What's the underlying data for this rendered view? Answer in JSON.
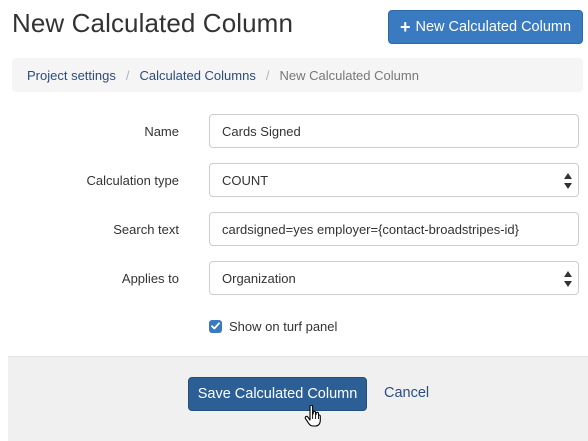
{
  "header": {
    "title": "New Calculated Column",
    "new_button_icon": "plus-icon",
    "new_button_label": "New Calculated Column"
  },
  "breadcrumb": {
    "items": [
      "Project settings",
      "Calculated Columns"
    ],
    "separator": "/",
    "current": "New Calculated Column"
  },
  "form": {
    "name": {
      "label": "Name",
      "value": "Cards Signed"
    },
    "calculation_type": {
      "label": "Calculation type",
      "value": "COUNT"
    },
    "search_text": {
      "label": "Search text",
      "value": "cardsigned=yes employer={contact-broadstripes-id}"
    },
    "applies_to": {
      "label": "Applies to",
      "value": "Organization"
    },
    "show_on_turf_panel": {
      "label": "Show on turf panel",
      "checked": true
    }
  },
  "footer": {
    "save_label": "Save Calculated Column",
    "cancel_label": "Cancel"
  },
  "colors": {
    "primary": "#3a7ac0",
    "primary_dark": "#2b5f96",
    "link": "#2a4d7f",
    "breadcrumb_bg": "#f5f5f5",
    "footer_bg": "#f0f0f0"
  },
  "icons": {
    "select_arrows": "updown-arrows-icon",
    "checkbox": "checkmark-icon",
    "pointer": "hand-pointer-icon"
  }
}
